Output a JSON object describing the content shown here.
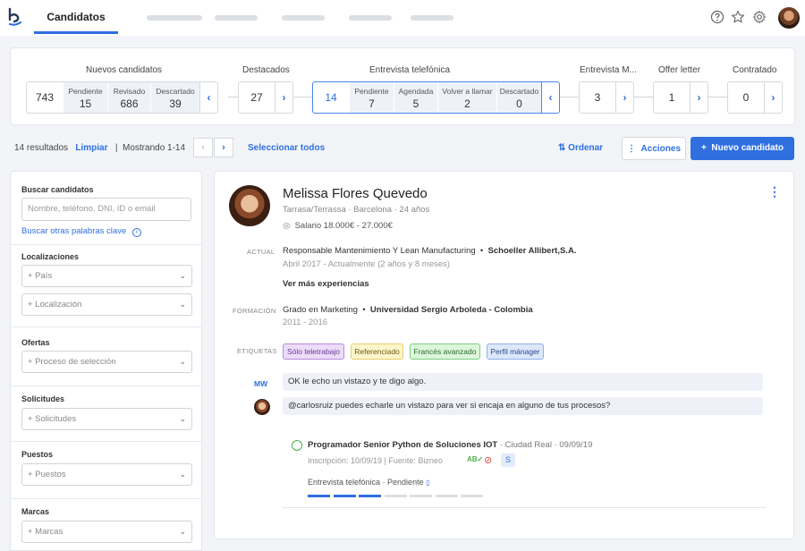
{
  "nav": {
    "active_tab": "Candidatos"
  },
  "pipeline": {
    "nuevos": {
      "title": "Nuevos candidatos",
      "total": "743",
      "subs": [
        {
          "label": "Pendiente",
          "value": "15"
        },
        {
          "label": "Revisado",
          "value": "686"
        },
        {
          "label": "Descartado",
          "value": "39"
        }
      ]
    },
    "destacados": {
      "title": "Destacados",
      "total": "27"
    },
    "entrevista_tel": {
      "title": "Entrevista telefónica",
      "total": "14",
      "subs": [
        {
          "label": "Pendiente",
          "value": "7"
        },
        {
          "label": "Agendada",
          "value": "5"
        },
        {
          "label": "Volver a llamar",
          "value": "2"
        },
        {
          "label": "Descartado",
          "value": "0"
        }
      ]
    },
    "entrevista_m": {
      "title": "Entrevista M...",
      "total": "3"
    },
    "offer": {
      "title": "Offer letter",
      "total": "1"
    },
    "contratado": {
      "title": "Contratado",
      "total": "0"
    }
  },
  "toolbar": {
    "results": "14 resultados",
    "clear": "Limpiar",
    "showing": "Mostrando 1-14",
    "select_all": "Seleccionar todos",
    "sort": "Ordenar",
    "actions": "Acciones",
    "new_candidate": "Nuevo candidato"
  },
  "sidebar": {
    "search_label": "Buscar candidatos",
    "search_placeholder": "Nombre, teléfono, DNI, ID o email",
    "search_other": "Buscar otras palabras clave",
    "localizaciones": "Localizaciones",
    "pais": "+ País",
    "localizacion": "+ Localización",
    "ofertas": "Ofertas",
    "proceso": "+ Proceso de selección",
    "solicitudes": "Solicitudes",
    "solicitudes_sel": "+ Solicitudes",
    "puestos": "Puestos",
    "puestos_sel": "+ Puestos",
    "marcas": "Marcas",
    "marcas_sel": "+ Marcas"
  },
  "candidate": {
    "name": "Melissa Flores Quevedo",
    "location": "Tarrasa/Terrassa · Barcelona · 24 años",
    "salary": "Salario 18.000€ - 27.000€",
    "actual_label": "ACTUAL",
    "job_title": "Responsable Mantenimiento Y Lean Manufacturing",
    "company": "Schoeller Allibert,S.A.",
    "job_dates": "Abril 2017 - Actualmente (2 años y 8 meses)",
    "more_exp": "Ver más experiencias",
    "formacion_label": "FORMACIÓN",
    "degree": "Grado en Marketing",
    "university": "Universidad Sergio Arboleda - Colombia",
    "edu_dates": "2011 - 2016",
    "tags_label": "ETIQUETAS",
    "tags": [
      "Sólo teletrabajo",
      "Referenciado",
      "Francés avanzado",
      "Perfil mánager"
    ],
    "comments": [
      {
        "author": "MW",
        "text": "OK le echo un vistazo y te digo algo."
      },
      {
        "text": "@carlosruiz puedes echarle un vistazo para ver si encaja en alguno de tus procesos?"
      }
    ],
    "application": {
      "title": "Programador Senior Python de Soluciones IOT",
      "meta": "· Ciudad Real · 09/09/19",
      "inscripcion": "Inscripción: 10/09/19 | Fuente: Bizneo",
      "badge": "S",
      "stage": "Entrevista telefónica · Pendiente",
      "progress_done": 3,
      "progress_total": 7
    }
  },
  "colors": {
    "accent": "#2f6fe0",
    "status_green": "#4caf50"
  }
}
